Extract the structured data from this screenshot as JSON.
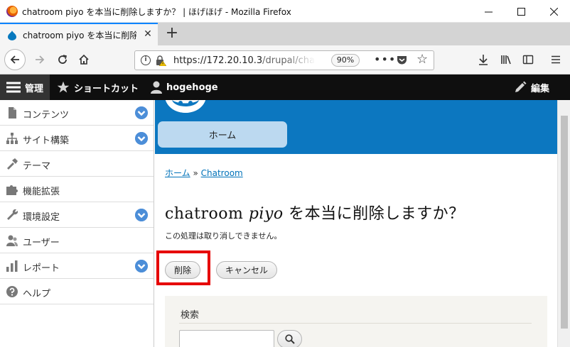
{
  "window": {
    "title": "chatroom piyo を本当に削除しますか？ | ほげほげ - Mozilla Firefox",
    "minimize_glyph": "—",
    "maximize_glyph": "☐",
    "close_glyph": "✕"
  },
  "tab": {
    "title": "chatroom piyo を本当に削除しま",
    "close_glyph": "✕",
    "new_tab_glyph": "+"
  },
  "nav": {
    "url_host": "https://172.20.10.3",
    "url_path": "/drupal/cha",
    "zoom": "90%",
    "more_glyph": "•••",
    "star_glyph": "☆"
  },
  "toolbar": {
    "manage": "管理",
    "shortcuts": "ショートカット",
    "user": "hogehoge",
    "edit": "編集"
  },
  "sidebar": {
    "items": [
      {
        "label": "コンテンツ",
        "icon": "file-icon"
      },
      {
        "label": "サイト構築",
        "icon": "sitemap-icon"
      },
      {
        "label": "テーマ",
        "icon": "brush-icon"
      },
      {
        "label": "機能拡張",
        "icon": "puzzle-icon"
      },
      {
        "label": "環境設定",
        "icon": "wrench-icon"
      },
      {
        "label": "ユーザー",
        "icon": "people-icon"
      },
      {
        "label": "レポート",
        "icon": "bar-chart-icon"
      },
      {
        "label": "ヘルプ",
        "icon": "help-icon"
      }
    ]
  },
  "site": {
    "home_tab": "ホーム"
  },
  "breadcrumb": {
    "home": "ホーム",
    "separator": "»",
    "current": "Chatroom"
  },
  "page": {
    "title_prefix": "chatroom",
    "title_name": "piyo",
    "title_suffix": "を本当に削除しますか？",
    "description": "この処理は取り消しできません。",
    "delete_button": "削除",
    "cancel_button": "キャンセル"
  },
  "search": {
    "title": "検索",
    "input_value": ""
  },
  "colors": {
    "accent_blue": "#0c77c0",
    "highlight_red": "#e60000",
    "toolbar_black": "#0f0f0f",
    "chevron_blue": "#4c8ed8"
  }
}
